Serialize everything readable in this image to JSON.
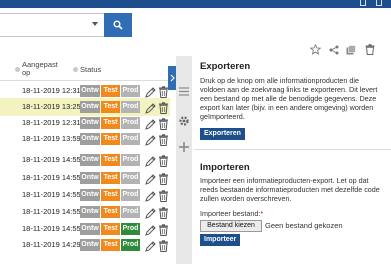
{
  "search": {
    "value": "",
    "placeholder": ""
  },
  "table": {
    "headers": {
      "changed": "Aangepast op",
      "status": "Status"
    },
    "rows": [
      {
        "date": "18-11-2019 12:31",
        "ontw": "Ontw",
        "test": "Test",
        "prod": "Prod",
        "prod_active": false,
        "selected": false
      },
      {
        "date": "18-11-2019 13:25",
        "ontw": "Ontw",
        "test": "Test",
        "prod": "Prod",
        "prod_active": false,
        "selected": true
      },
      {
        "date": "18-11-2019 12:31",
        "ontw": "Ontw",
        "test": "Test",
        "prod": "Prod",
        "prod_active": false,
        "selected": false
      },
      {
        "date": "18-11-2019 13:59",
        "ontw": "Ontw",
        "test": "Test",
        "prod": "Prod",
        "prod_active": false,
        "selected": false
      },
      {
        "date": "18-11-2019 14:55",
        "ontw": "Ontw",
        "test": "Test",
        "prod": "Prod",
        "prod_active": false,
        "selected": false
      },
      {
        "date": "18-11-2019 14:55",
        "ontw": "Ontw",
        "test": "Test",
        "prod": "Prod",
        "prod_active": false,
        "selected": false
      },
      {
        "date": "18-11-2019 14:55",
        "ontw": "Ontw",
        "test": "Test",
        "prod": "Prod",
        "prod_active": false,
        "selected": false
      },
      {
        "date": "18-11-2019 14:55",
        "ontw": "Ontw",
        "test": "Test",
        "prod": "Prod",
        "prod_active": false,
        "selected": false
      },
      {
        "date": "18-11-2019 14:55",
        "ontw": "Ontw",
        "test": "Test",
        "prod": "Prod",
        "prod_active": true,
        "selected": false
      },
      {
        "date": "18-11-2019 14:29",
        "ontw": "Ontw",
        "test": "Test",
        "prod": "Prod",
        "prod_active": true,
        "selected": false
      }
    ]
  },
  "export": {
    "title": "Exporteren",
    "description": "Druk op de knop om alle informationproducten die voldoen aan de zoekvraag links te exporteren. Dit levert een bestand op met alle de benodigde gegevens. Deze export kan later (bijv. in een andere omgeving) worden geïmporteerd.",
    "button": "Exporteren"
  },
  "import": {
    "title": "Importeren",
    "description": "Importeer een informatieproducten-export. Let op dat reeds bestaande informatieproducten met dezelfde code zullen worden overschreven.",
    "file_label": "Importeer bestand:",
    "required_mark": "*",
    "choose_button": "Bestand kiezen",
    "file_status": "Geen bestand gekozen",
    "button": "Importeer"
  },
  "colors": {
    "brand": "#1d4f8d",
    "accent": "#2f6db5",
    "test": "#f08a1c",
    "prod_active": "#2e8b3a",
    "selected_row": "#f3f3c2"
  },
  "icons": {
    "toolbar": [
      "star-icon",
      "share-icon",
      "copy-icon",
      "delete-icon"
    ],
    "side": [
      "list-icon",
      "settings-icon",
      "add-icon"
    ],
    "row": [
      "edit-icon",
      "trash-icon"
    ]
  }
}
